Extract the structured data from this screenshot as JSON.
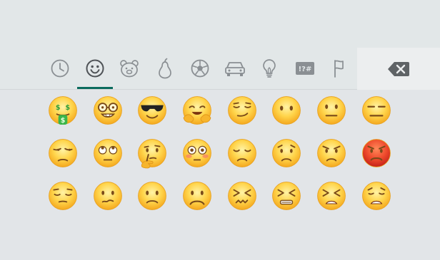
{
  "tabs": [
    {
      "icon": "recent-clock-icon",
      "active": false
    },
    {
      "icon": "smiley-icon",
      "active": true
    },
    {
      "icon": "animal-bear-icon",
      "active": false
    },
    {
      "icon": "pear-food-icon",
      "active": false
    },
    {
      "icon": "soccer-ball-icon",
      "active": false
    },
    {
      "icon": "car-icon",
      "active": false
    },
    {
      "icon": "lightbulb-icon",
      "active": false
    },
    {
      "icon": "symbols-icon",
      "active": false
    },
    {
      "icon": "flag-icon",
      "active": false
    }
  ],
  "symbols_tab_label": "!?#",
  "backspace": {
    "icon": "backspace-icon"
  },
  "colors": {
    "background": "#e2e5e8",
    "tab_active_underline": "#0a6b5d",
    "emoji_face": "#f7c43a",
    "angry_face": "#e8452f"
  },
  "emojis": [
    {
      "name": "money-mouth-face",
      "face": "money"
    },
    {
      "name": "nerd-face",
      "face": "nerd"
    },
    {
      "name": "smiling-face-with-sunglasses",
      "face": "cool"
    },
    {
      "name": "hugging-face",
      "face": "hug"
    },
    {
      "name": "smirking-face",
      "face": "smirk"
    },
    {
      "name": "face-without-mouth",
      "face": "nomouth"
    },
    {
      "name": "neutral-face",
      "face": "neutral"
    },
    {
      "name": "expressionless-face",
      "face": "expressionless"
    },
    {
      "name": "unamused-face",
      "face": "unamused"
    },
    {
      "name": "face-with-rolling-eyes",
      "face": "rolling"
    },
    {
      "name": "thinking-face",
      "face": "thinking"
    },
    {
      "name": "flushed-face",
      "face": "flushed"
    },
    {
      "name": "disappointed-face",
      "face": "disappointed"
    },
    {
      "name": "worried-face",
      "face": "worried"
    },
    {
      "name": "angry-face",
      "face": "angry"
    },
    {
      "name": "pouting-face",
      "face": "pouting"
    },
    {
      "name": "pensive-face",
      "face": "pensive"
    },
    {
      "name": "confused-face",
      "face": "confused"
    },
    {
      "name": "slightly-frowning-face",
      "face": "slightfrown"
    },
    {
      "name": "frowning-face",
      "face": "frown"
    },
    {
      "name": "confounded-face",
      "face": "confounded"
    },
    {
      "name": "persevering-face",
      "face": "persevering"
    },
    {
      "name": "tired-face",
      "face": "tired"
    },
    {
      "name": "weary-face",
      "face": "weary"
    }
  ]
}
